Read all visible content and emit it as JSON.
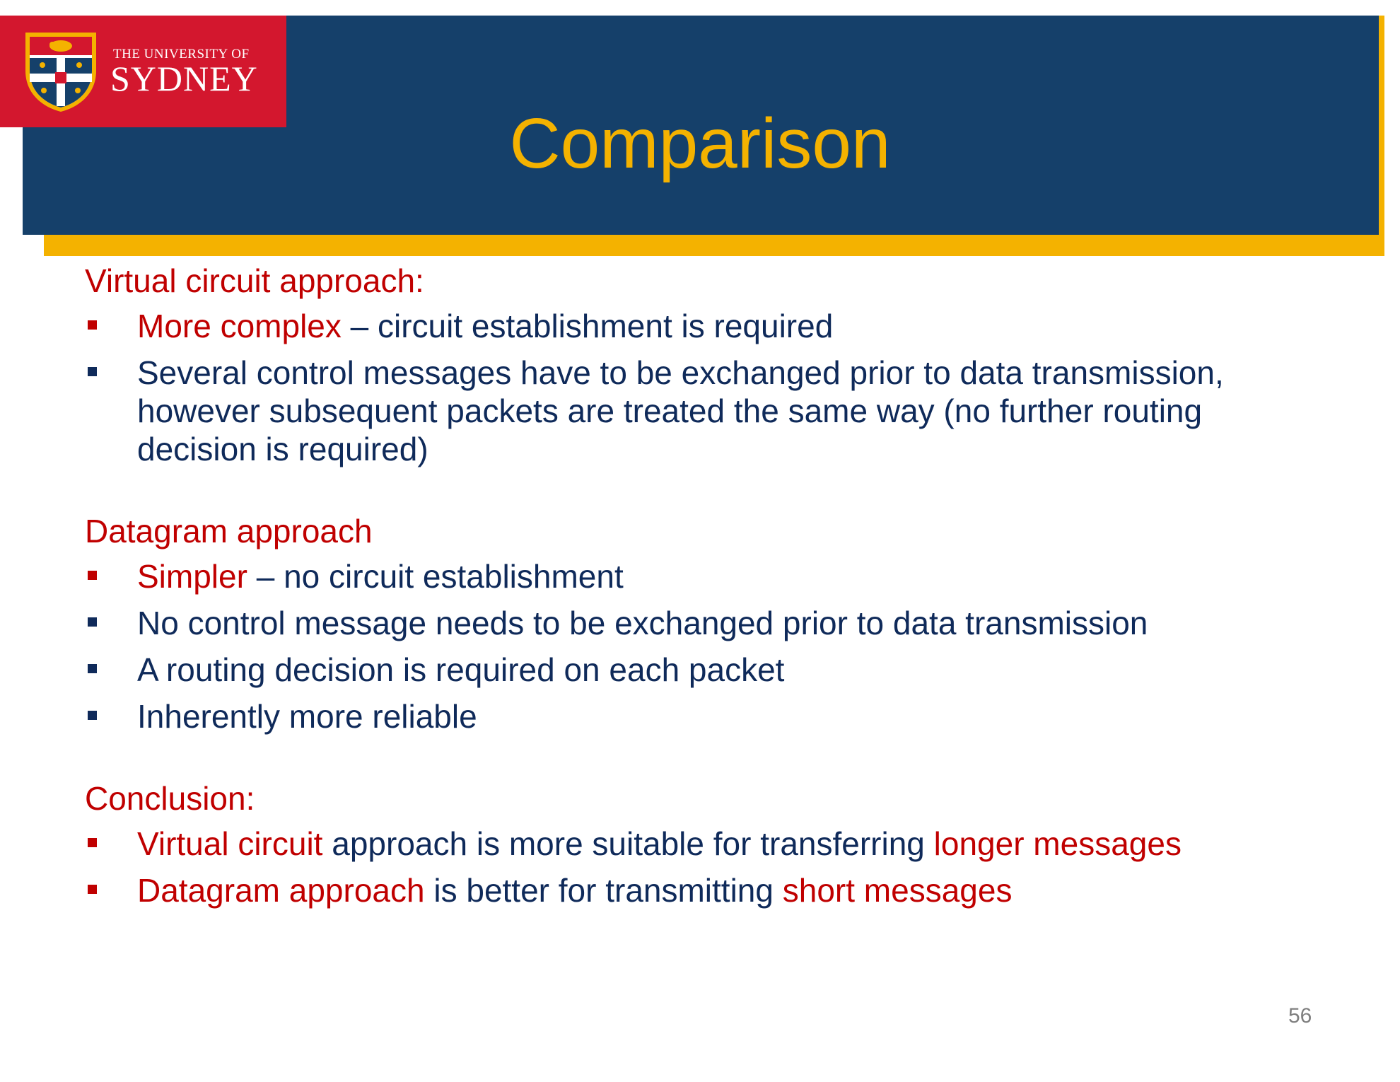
{
  "logo": {
    "line1": "THE UNIVERSITY OF",
    "line2": "SYDNEY"
  },
  "title": "Comparison",
  "sections": {
    "virtual": {
      "heading": "Virtual circuit approach:",
      "b1_red": "More complex",
      "b1_rest": " – circuit establishment is required",
      "b2": "Several control messages have to be exchanged prior to data transmission, however subsequent packets are treated the same way (no further routing decision is required)"
    },
    "datagram": {
      "heading": "Datagram approach",
      "b1_red": "Simpler",
      "b1_rest": " – no circuit establishment",
      "b2": "No control message needs to be exchanged prior to data transmission",
      "b3": "A routing decision is required on each packet",
      "b4": "Inherently more reliable"
    },
    "conclusion": {
      "heading": "Conclusion:",
      "b1_red1": "Virtual circuit",
      "b1_mid": " approach is more suitable for transferring ",
      "b1_red2": "longer messages",
      "b2_red1": "Datagram approach",
      "b2_mid": " is better for transmitting ",
      "b2_red2": "short messages"
    }
  },
  "page_number": "56",
  "colors": {
    "header_blue": "#15406a",
    "accent_gold": "#f4b200",
    "logo_red": "#d3172e",
    "heading_red": "#c00000",
    "body_navy": "#0f2a5a"
  }
}
